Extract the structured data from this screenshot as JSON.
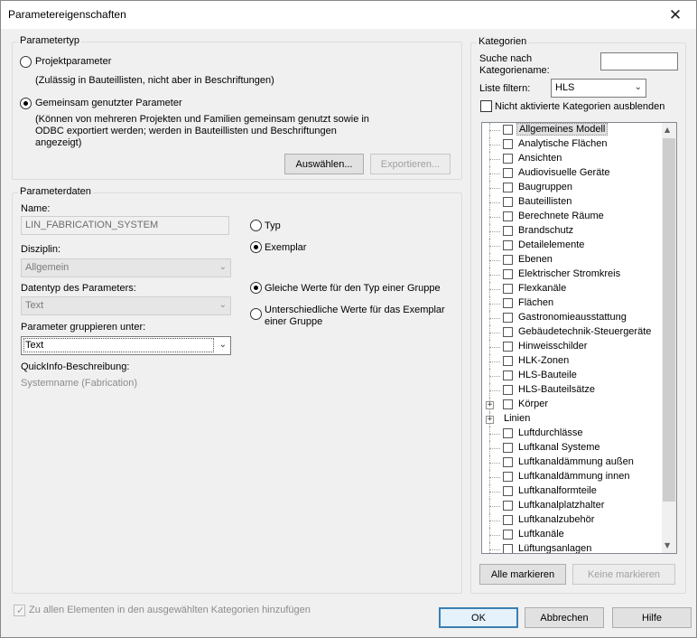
{
  "window": {
    "title": "Parametereigenschaften",
    "close_glyph": "✕"
  },
  "parametertyp": {
    "group_title": "Parametertyp",
    "option_projekt": "Projektparameter",
    "option_projekt_desc": "(Zulässig in Bauteillisten, nicht aber in Beschriftungen)",
    "option_gemeinsam": "Gemeinsam genutzter Parameter",
    "option_gemeinsam_desc": [
      "(Können von mehreren Projekten und Familien gemeinsam genutzt sowie in",
      "ODBC exportiert werden; werden in Bauteillisten und Beschriftungen",
      "angezeigt)"
    ],
    "selected": "gemeinsam",
    "btn_auswaehlen": "Auswählen...",
    "btn_exportieren": "Exportieren..."
  },
  "parameterdaten": {
    "group_title": "Parameterdaten",
    "name_label": "Name:",
    "name_value": "LIN_FABRICATION_SYSTEM",
    "disziplin_label": "Disziplin:",
    "disziplin_value": "Allgemein",
    "datentyp_label": "Datentyp des Parameters:",
    "datentyp_value": "Text",
    "gruppieren_label": "Parameter gruppieren unter:",
    "gruppieren_value": "Text",
    "quickinfo_label": "QuickInfo-Beschreibung:",
    "quickinfo_value": "Systemname (Fabrication)",
    "option_typ": "Typ",
    "option_exemplar": "Exemplar",
    "option_gleiche": "Gleiche Werte für den Typ einer Gruppe",
    "option_unterschiedliche": [
      "Unterschiedliche Werte für das Exemplar",
      "einer Gruppe"
    ]
  },
  "kategorien": {
    "group_title": "Kategorien",
    "suche_label": [
      "Suche nach",
      "Kategoriename:"
    ],
    "suche_value": "",
    "filter_label": "Liste filtern:",
    "filter_value": "HLS",
    "hide_inactive_label": "Nicht aktivierte Kategorien ausblenden",
    "items": [
      {
        "label": "Allgemeines Modell",
        "selected": true
      },
      {
        "label": "Analytische Flächen"
      },
      {
        "label": "Ansichten"
      },
      {
        "label": "Audiovisuelle Geräte"
      },
      {
        "label": "Baugruppen"
      },
      {
        "label": "Bauteillisten"
      },
      {
        "label": "Berechnete Räume"
      },
      {
        "label": "Brandschutz"
      },
      {
        "label": "Detailelemente"
      },
      {
        "label": "Ebenen"
      },
      {
        "label": "Elektrischer Stromkreis"
      },
      {
        "label": "Flexkanäle"
      },
      {
        "label": "Flächen"
      },
      {
        "label": "Gastronomieausstattung"
      },
      {
        "label": "Gebäudetechnik-Steuergeräte"
      },
      {
        "label": "Hinweisschilder"
      },
      {
        "label": "HLK-Zonen"
      },
      {
        "label": "HLS-Bauteile"
      },
      {
        "label": "HLS-Bauteilsätze"
      },
      {
        "label": "Körper",
        "expandable": true
      },
      {
        "label": "Linien",
        "expandable": true,
        "no_checkbox": true
      },
      {
        "label": "Luftdurchlässe"
      },
      {
        "label": "Luftkanal Systeme"
      },
      {
        "label": "Luftkanaldämmung außen"
      },
      {
        "label": "Luftkanaldämmung innen"
      },
      {
        "label": "Luftkanalformteile"
      },
      {
        "label": "Luftkanalplatzhalter"
      },
      {
        "label": "Luftkanalzubehör"
      },
      {
        "label": "Luftkanäle"
      },
      {
        "label": "Lüftungsanlagen"
      }
    ],
    "btn_alle": "Alle markieren",
    "btn_keine": "Keine markieren"
  },
  "footer": {
    "add_all_label": "Zu allen Elementen in den ausgewählten Kategorien hinzufügen",
    "btn_ok": "OK",
    "btn_abbrechen": "Abbrechen",
    "btn_hilfe": "Hilfe"
  }
}
